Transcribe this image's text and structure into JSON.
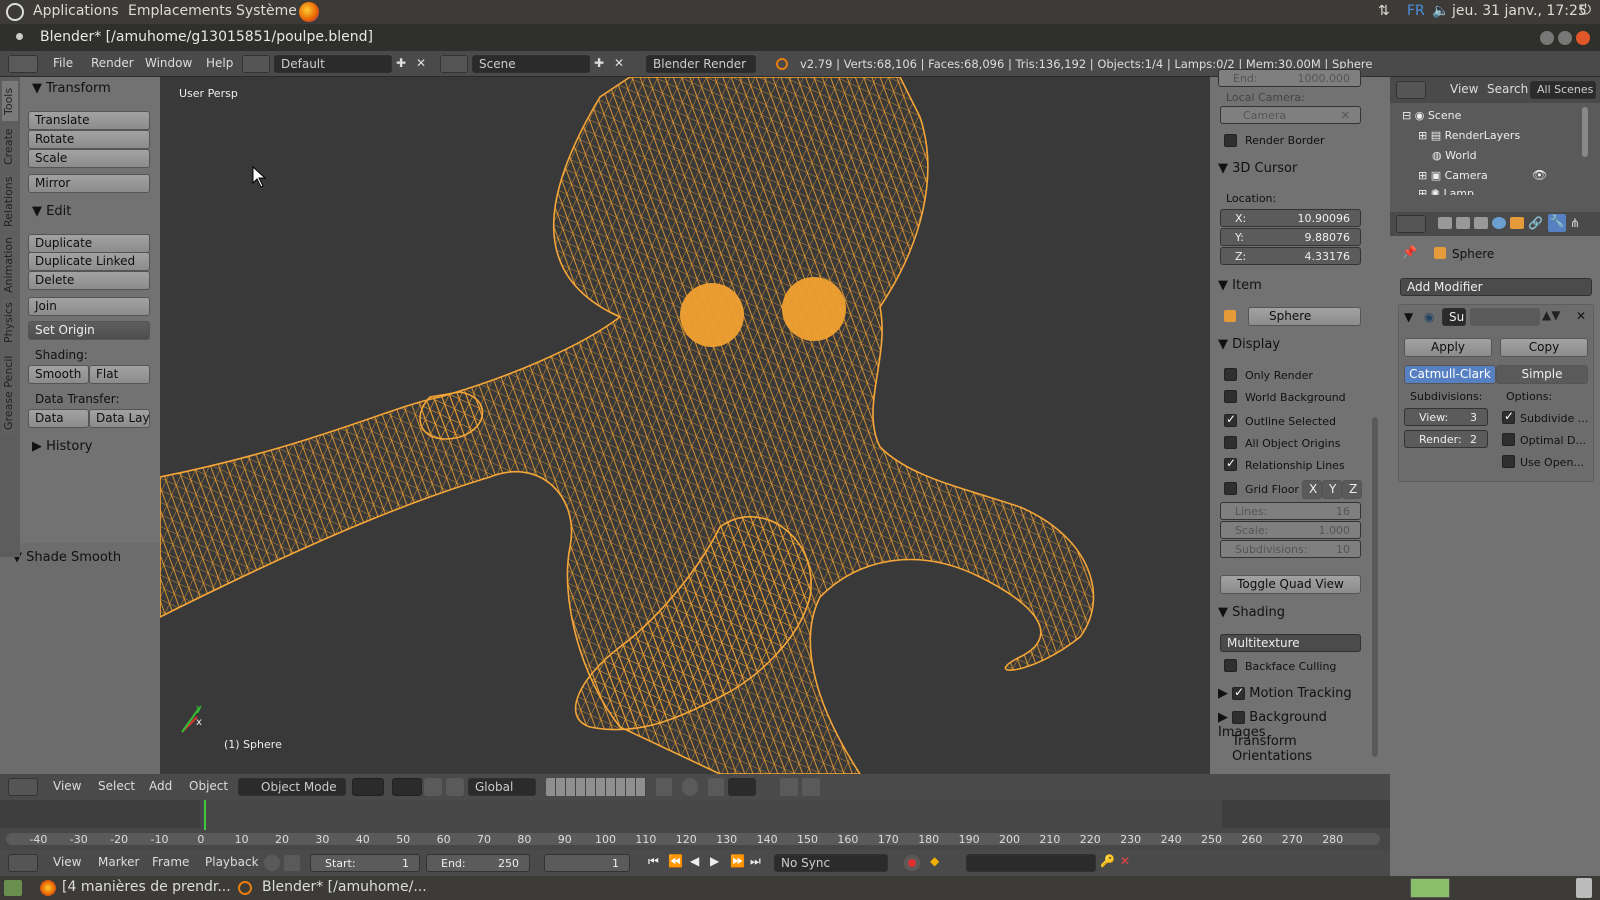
{
  "topbar": {
    "applications": "Applications",
    "places": "Emplacements",
    "system": "Système",
    "lang": "FR",
    "datetime": "jeu. 31 janv., 17:25"
  },
  "titlebar": {
    "title": "Blender* [/amuhome/g13015851/poulpe.blend]"
  },
  "infobar": {
    "menus": [
      "File",
      "Render",
      "Window",
      "Help"
    ],
    "layout": "Default",
    "scene": "Scene",
    "engine": "Blender Render",
    "stats": "v2.79 | Verts:68,106 | Faces:68,096 | Tris:136,192 | Objects:1/4 | Lamps:0/2 | Mem:30.00M | Sphere"
  },
  "toolshelf": {
    "tabs": [
      "Tools",
      "Create",
      "Relations",
      "Animation",
      "Physics",
      "Grease Pencil"
    ],
    "transform_header": "Transform",
    "translate": "Translate",
    "rotate": "Rotate",
    "scale": "Scale",
    "mirror": "Mirror",
    "edit_header": "Edit",
    "duplicate": "Duplicate",
    "duplicate_linked": "Duplicate Linked",
    "delete": "Delete",
    "join": "Join",
    "set_origin": "Set Origin",
    "shading_label": "Shading:",
    "smooth": "Smooth",
    "flat": "Flat",
    "data_transfer_label": "Data Transfer:",
    "data": "Data",
    "data_layo": "Data Layo",
    "history": "History",
    "shade_smooth": "Shade Smooth"
  },
  "viewport": {
    "view_name": "User Persp",
    "object_label": "(1) Sphere",
    "wire_color": "#f0a030"
  },
  "npanel": {
    "end_label": "End:",
    "end_value": "1000.000",
    "local_camera_label": "Local Camera:",
    "camera_field": "Camera",
    "render_border": "Render Border",
    "cursor_header": "3D Cursor",
    "location_label": "Location:",
    "x_label": "X:",
    "x_value": "10.90096",
    "y_label": "Y:",
    "y_value": "9.88076",
    "z_label": "Z:",
    "z_value": "4.33176",
    "item_header": "Item",
    "item_name": "Sphere",
    "display_header": "Display",
    "only_render": "Only Render",
    "world_background": "World Background",
    "outline_selected": "Outline Selected",
    "all_object_origins": "All Object Origins",
    "relationship_lines": "Relationship Lines",
    "grid_floor": "Grid Floor",
    "axis_x": "X",
    "axis_y": "Y",
    "axis_z": "Z",
    "lines_label": "Lines:",
    "lines_value": "16",
    "scale_label": "Scale:",
    "scale_value": "1.000",
    "subdiv_label": "Subdivisions:",
    "subdiv_value": "10",
    "toggle_quad": "Toggle Quad View",
    "shading_header": "Shading",
    "shading_mode": "Multitexture",
    "backface_culling": "Backface Culling",
    "motion_tracking": "Motion Tracking",
    "background_images": "Background Images",
    "transform_orientations": "Transform Orientations"
  },
  "outliner": {
    "view": "View",
    "search": "Search",
    "all_scenes": "All Scenes",
    "items": [
      "Scene",
      "RenderLayers",
      "World",
      "Camera",
      "Lamp"
    ]
  },
  "properties": {
    "object_name": "Sphere",
    "add_modifier": "Add Modifier",
    "modifier_name": "Su",
    "apply": "Apply",
    "copy": "Copy",
    "catmull": "Catmull-Clark",
    "simple": "Simple",
    "subdivisions_label": "Subdivisions:",
    "options_label": "Options:",
    "view_label": "View:",
    "view_value": "3",
    "render_label": "Render:",
    "render_value": "2",
    "opt1": "Subdivide ...",
    "opt2": "Optimal D...",
    "opt3": "Use Open..."
  },
  "vpheader": {
    "view": "View",
    "select": "Select",
    "add": "Add",
    "object": "Object",
    "mode": "Object Mode",
    "orientation": "Global"
  },
  "timeline": {
    "ticks": [
      "-40",
      "-30",
      "-20",
      "-10",
      "0",
      "10",
      "20",
      "30",
      "40",
      "50",
      "60",
      "70",
      "80",
      "90",
      "100",
      "110",
      "120",
      "130",
      "140",
      "150",
      "160",
      "170",
      "180",
      "190",
      "200",
      "210",
      "220",
      "230",
      "240",
      "250",
      "260",
      "270",
      "280"
    ],
    "current_frame": 1
  },
  "tlheader": {
    "view": "View",
    "marker": "Marker",
    "frame": "Frame",
    "playback": "Playback",
    "start_label": "Start:",
    "start_value": "1",
    "end_label": "End:",
    "end_value": "250",
    "current": "1",
    "sync": "No Sync"
  },
  "taskbar": {
    "task1": "[4 manières de prendr...",
    "task2": "Blender* [/amuhome/..."
  }
}
